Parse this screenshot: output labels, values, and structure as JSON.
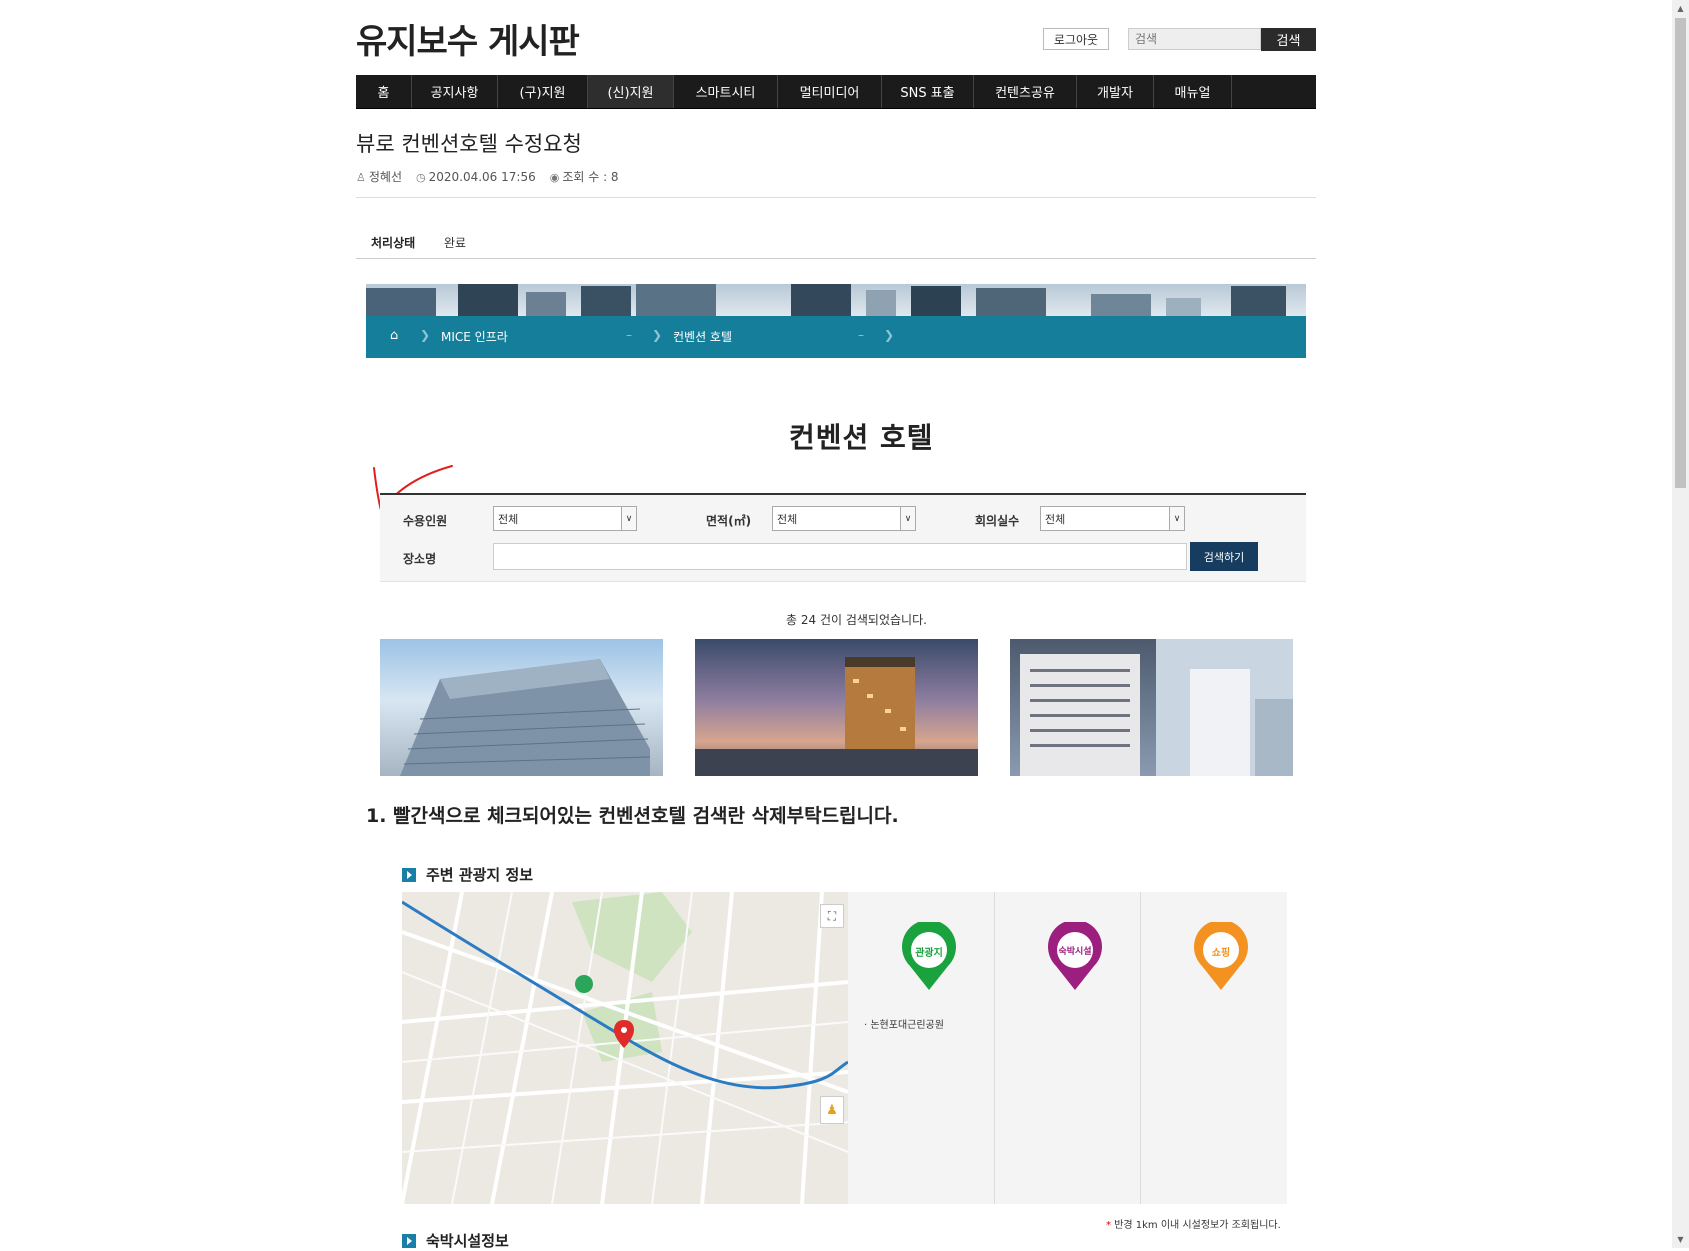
{
  "header": {
    "site_title": "유지보수 게시판",
    "logout_label": "로그아웃",
    "search_placeholder": "검색",
    "search_button": "검색"
  },
  "nav": {
    "items": [
      "홈",
      "공지사항",
      "(구)지원",
      "(신)지원",
      "스마트시티",
      "멀티미디어",
      "SNS 표출",
      "컨텐츠공유",
      "개발자",
      "매뉴얼"
    ]
  },
  "post": {
    "title": "뷰로 컨벤션호텔 수정요청",
    "author": "정혜선",
    "datetime": "2020.04.06 17:56",
    "views": "조회 수 : 8",
    "status_label": "처리상태",
    "status_value": "완료"
  },
  "attachment": {
    "breadcrumb": [
      "MICE 인프라",
      "컨벤션 호텔"
    ],
    "heading": "컨벤션 호텔",
    "form": {
      "capacity_label": "수용인원",
      "capacity_value": "전체",
      "area_label": "면적(㎡)",
      "area_value": "전체",
      "rooms_label": "회의실수",
      "rooms_value": "전체",
      "place_label": "장소명",
      "search_button": "검색하기"
    },
    "result_count": "총 24 건이 검색되었습니다.",
    "note": "1. 빨간색으로 체크되어있는 컨벤션호텔 검색란 삭제부탁드립니다.",
    "tour_section_title": "주변 관광지 정보",
    "stay_section_title": "숙박시설정보",
    "pins": [
      "관광지",
      "숙박시설",
      "쇼핑"
    ],
    "pin_colors": [
      "#1aa23f",
      "#9c1f7f",
      "#f39221"
    ],
    "nearby_item": "· 논현포대근린공원",
    "radius_note": "반경 1km 이내 시설정보가 조회됩니다."
  },
  "colors": {
    "nav_bg": "#1b1b1b",
    "banner_bar": "#157f9b",
    "form_button": "#163c5f",
    "section_icon": "#1a7fa6"
  }
}
